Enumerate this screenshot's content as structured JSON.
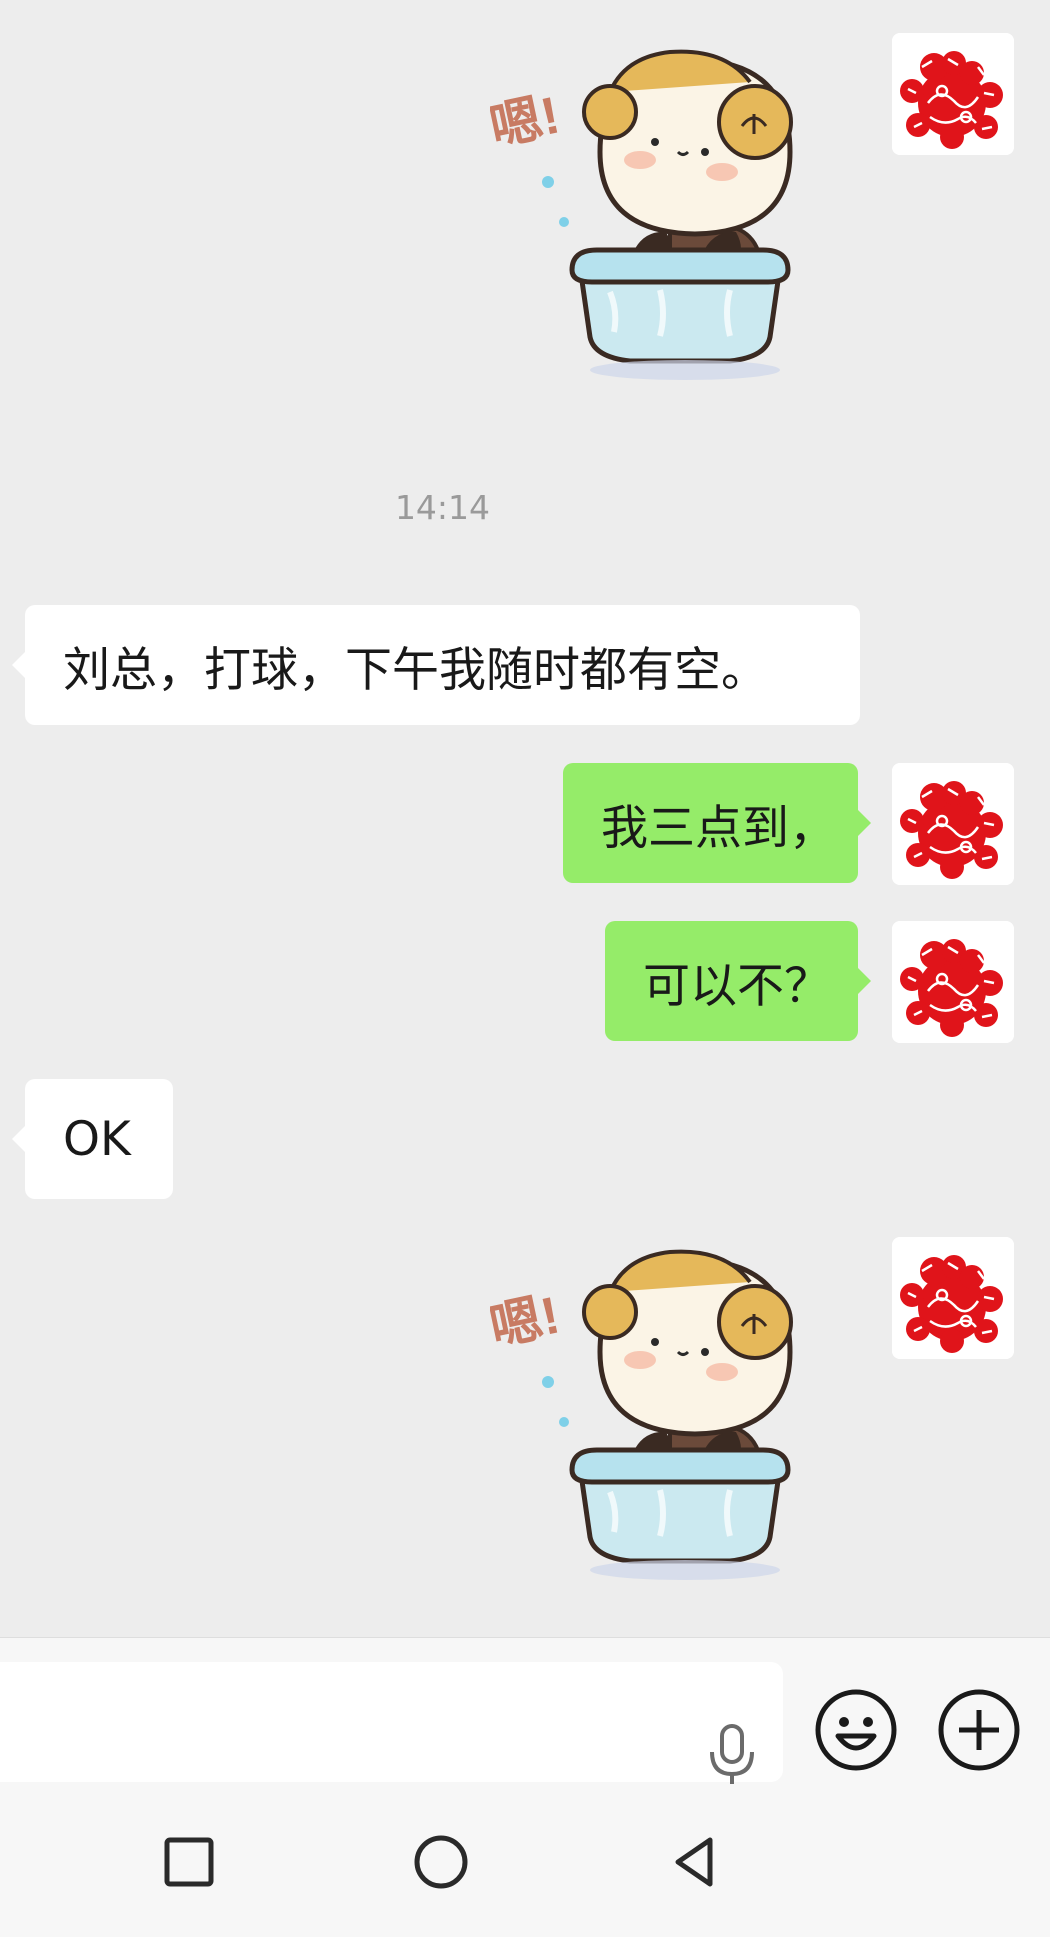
{
  "conversation": {
    "timestamp": "14:14",
    "messages": [
      {
        "side": "incoming",
        "text": "刘总，打球，下午我随时都有空。"
      },
      {
        "side": "outgoing",
        "text": "我三点到，"
      },
      {
        "side": "outgoing",
        "text": "可以不？"
      },
      {
        "side": "incoming",
        "text": "OK"
      }
    ],
    "stickers": [
      {
        "caption": "嗯!",
        "character": "sheep-in-bathtub"
      },
      {
        "caption": "嗯!",
        "character": "sheep-in-bathtub"
      }
    ]
  },
  "composer": {
    "input_value": "",
    "icons": {
      "voice": "microphone-icon",
      "emoji": "smiley-face-icon",
      "more": "plus-circle-icon"
    }
  },
  "navigation": {
    "icons": {
      "recents": "square-icon",
      "home": "circle-icon",
      "back": "triangle-back-icon"
    }
  },
  "colors": {
    "chat_background": "#ededed",
    "outgoing_bubble": "#95ec69",
    "incoming_bubble": "#ffffff",
    "papercut_red": "#e0141a",
    "timestamp_text": "#9a9a9a"
  }
}
